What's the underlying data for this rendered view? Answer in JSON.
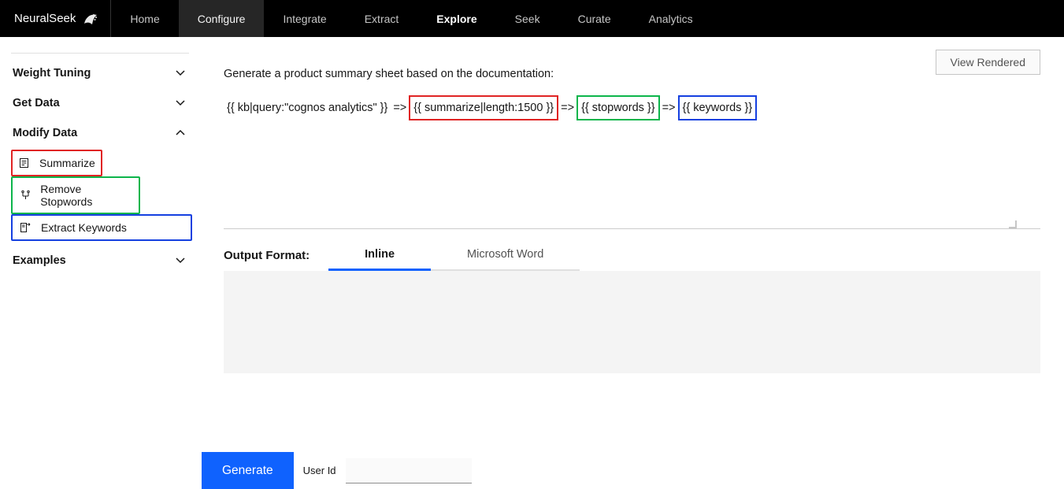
{
  "brand": {
    "name": "NeuralSeek"
  },
  "nav": [
    {
      "label": "Home",
      "state": ""
    },
    {
      "label": "Configure",
      "state": "hover"
    },
    {
      "label": "Integrate",
      "state": ""
    },
    {
      "label": "Extract",
      "state": ""
    },
    {
      "label": "Explore",
      "state": "active"
    },
    {
      "label": "Seek",
      "state": ""
    },
    {
      "label": "Curate",
      "state": ""
    },
    {
      "label": "Analytics",
      "state": ""
    }
  ],
  "sidebar": {
    "sections": {
      "weight_tuning": {
        "label": "Weight Tuning",
        "expanded": false
      },
      "get_data": {
        "label": "Get Data",
        "expanded": false
      },
      "modify_data": {
        "label": "Modify Data",
        "expanded": true
      },
      "examples": {
        "label": "Examples",
        "expanded": false
      }
    },
    "modify_items": [
      {
        "label": "Summarize",
        "hl": "red"
      },
      {
        "label": "Remove Stopwords",
        "hl": "green"
      },
      {
        "label": "Extract Keywords",
        "hl": "blue"
      }
    ]
  },
  "main": {
    "view_rendered_label": "View Rendered",
    "prompt_text": "Generate a product summary sheet based on the documentation:",
    "tokens": {
      "kb": "{{ kb|query:\"cognos analytics\" }}",
      "arrow1": "=>",
      "summarize": "{{ summarize|length:1500 }}",
      "arrow2": "=>",
      "stopwords": "{{ stopwords }}",
      "arrow3": "=>",
      "keywords": "{{ keywords }}"
    },
    "output_format": {
      "label": "Output Format:",
      "tabs": [
        {
          "label": "Inline",
          "active": true
        },
        {
          "label": "Microsoft Word",
          "active": false
        }
      ]
    }
  },
  "bottom": {
    "generate_label": "Generate",
    "userid_label": "User Id",
    "userid_value": ""
  }
}
